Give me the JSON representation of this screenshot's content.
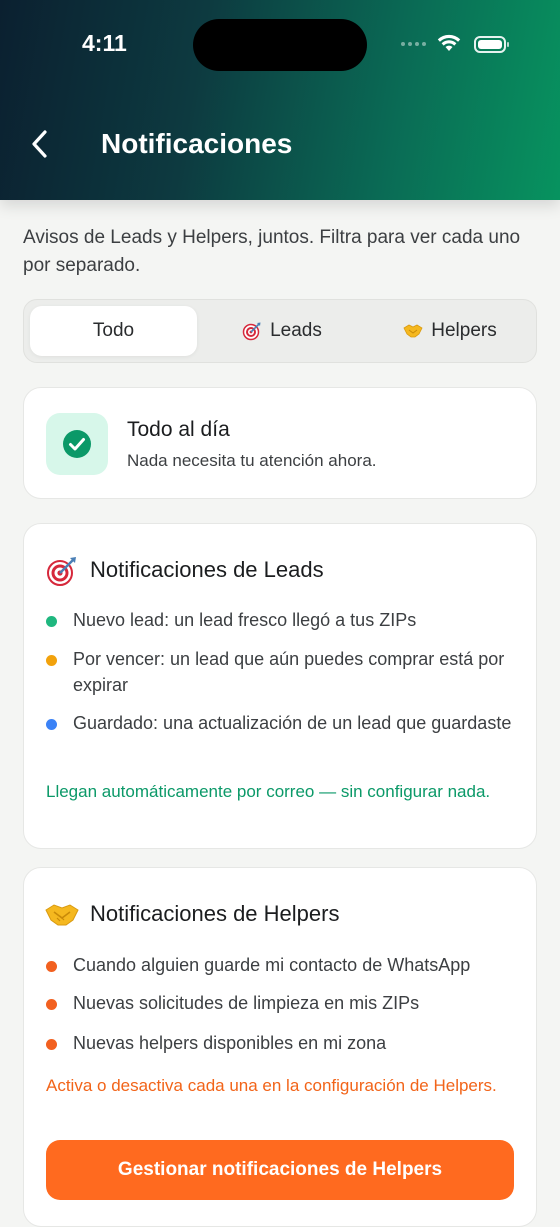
{
  "status_bar": {
    "time": "4:11"
  },
  "header": {
    "title": "Notificaciones",
    "back_icon": "chevron-left-icon"
  },
  "intro": "Avisos de Leads y Helpers, juntos. Filtra para ver cada uno por separado.",
  "filter": {
    "tabs": [
      {
        "label": "Todo",
        "icon": "",
        "active": true
      },
      {
        "label": "Leads",
        "icon": "target-icon",
        "active": false
      },
      {
        "label": "Helpers",
        "icon": "handshake-icon",
        "active": false
      }
    ]
  },
  "status_card": {
    "icon": "check-circle-icon",
    "title": "Todo al día",
    "subtitle": "Nada necesita tu atención ahora."
  },
  "leads_section": {
    "icon": "target-icon",
    "title": "Notificaciones de Leads",
    "items": [
      {
        "text": "Nuevo lead: un lead fresco llegó a tus ZIPs",
        "color": "#1fb77f"
      },
      {
        "text": "Por vencer: un lead que aún puedes comprar está por expirar",
        "color": "#f2a20c"
      },
      {
        "text": "Guardado: una actualización de un lead que guardaste",
        "color": "#3b82f6"
      }
    ],
    "note": "Llegan automáticamente por correo — sin configurar nada.",
    "note_color": "#0b9968"
  },
  "helpers_section": {
    "icon": "handshake-icon",
    "title": "Notificaciones de Helpers",
    "items": [
      {
        "text": "Cuando alguien guarde mi contacto de WhatsApp",
        "color": "#f2601f"
      },
      {
        "text": "Nuevas solicitudes de limpieza en mis ZIPs",
        "color": "#f2601f"
      },
      {
        "text": "Nuevas helpers disponibles en mi zona",
        "color": "#f2601f"
      }
    ],
    "note": "Activa o desactiva cada una en la configuración de Helpers.",
    "note_color": "#f26419",
    "button": "Gestionar notificaciones de Helpers"
  },
  "colors": {
    "accent_green": "#0b9968",
    "accent_orange": "#ff6a1f",
    "header_gradient": [
      "#0b2030",
      "#07935f"
    ]
  }
}
